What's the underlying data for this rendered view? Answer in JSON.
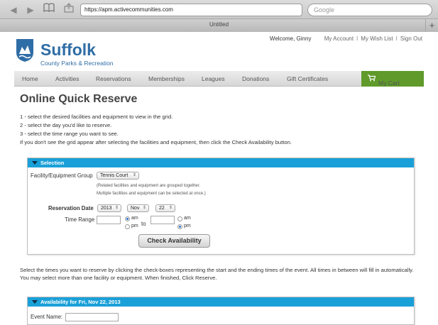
{
  "browser": {
    "url": "https://apm.activecommunities.com",
    "search_placeholder": "Google",
    "tab_title": "Untitled",
    "new_tab": "+"
  },
  "brand": {
    "name": "Suffolk",
    "subtitle": "County Parks & Recreation",
    "color": "#2f6da6"
  },
  "user": {
    "welcome": "Welcome, Ginny",
    "links": [
      "My Account",
      "My Wish List",
      "Sign Out"
    ],
    "separator": "I"
  },
  "nav": {
    "items": [
      "Home",
      "Activities",
      "Reservations",
      "Memberships",
      "Leagues",
      "Donations",
      "Gift Certificates"
    ],
    "cart": "My Cart",
    "cart_color": "#5f9a2b"
  },
  "page": {
    "title": "Online Quick Reserve",
    "instructions": [
      "1 - select the desired facilities and equipment to view in the grid.",
      "2 - select the day you'd like to reserve.",
      "3 - select the time range you want to see.",
      "If you don't see the grid appear after selecting the facilities and equipment, then click the Check Availability button."
    ]
  },
  "selection": {
    "header": "Selection",
    "group_label": "Facility/Equipment Group",
    "group_value": "Tennis Court",
    "note1": "(Related facilities and equipment are grouped together.",
    "note2": "Multiple facilities and equipment can be selected at once.)",
    "date_label": "Reservation Date",
    "year": "2013",
    "month": "Nov",
    "day": "22",
    "time_label": "Time Range",
    "to": "to",
    "am": "am",
    "pm": "pm",
    "start_meridiem": "am",
    "end_meridiem": "pm",
    "check_button": "Check Availability",
    "header_color": "#1aa0d8"
  },
  "grid_instructions": {
    "line1": "Select the times you want to reserve by clicking the check-boxes representing the start and the ending times of the event. All times in between will fill in automatically.",
    "line2": "You may select more than one facility or equipment. When finished, Click Reserve."
  },
  "availability": {
    "header": "Availability for Fri, Nov 22, 2013",
    "event_name_label": "Event Name:"
  }
}
